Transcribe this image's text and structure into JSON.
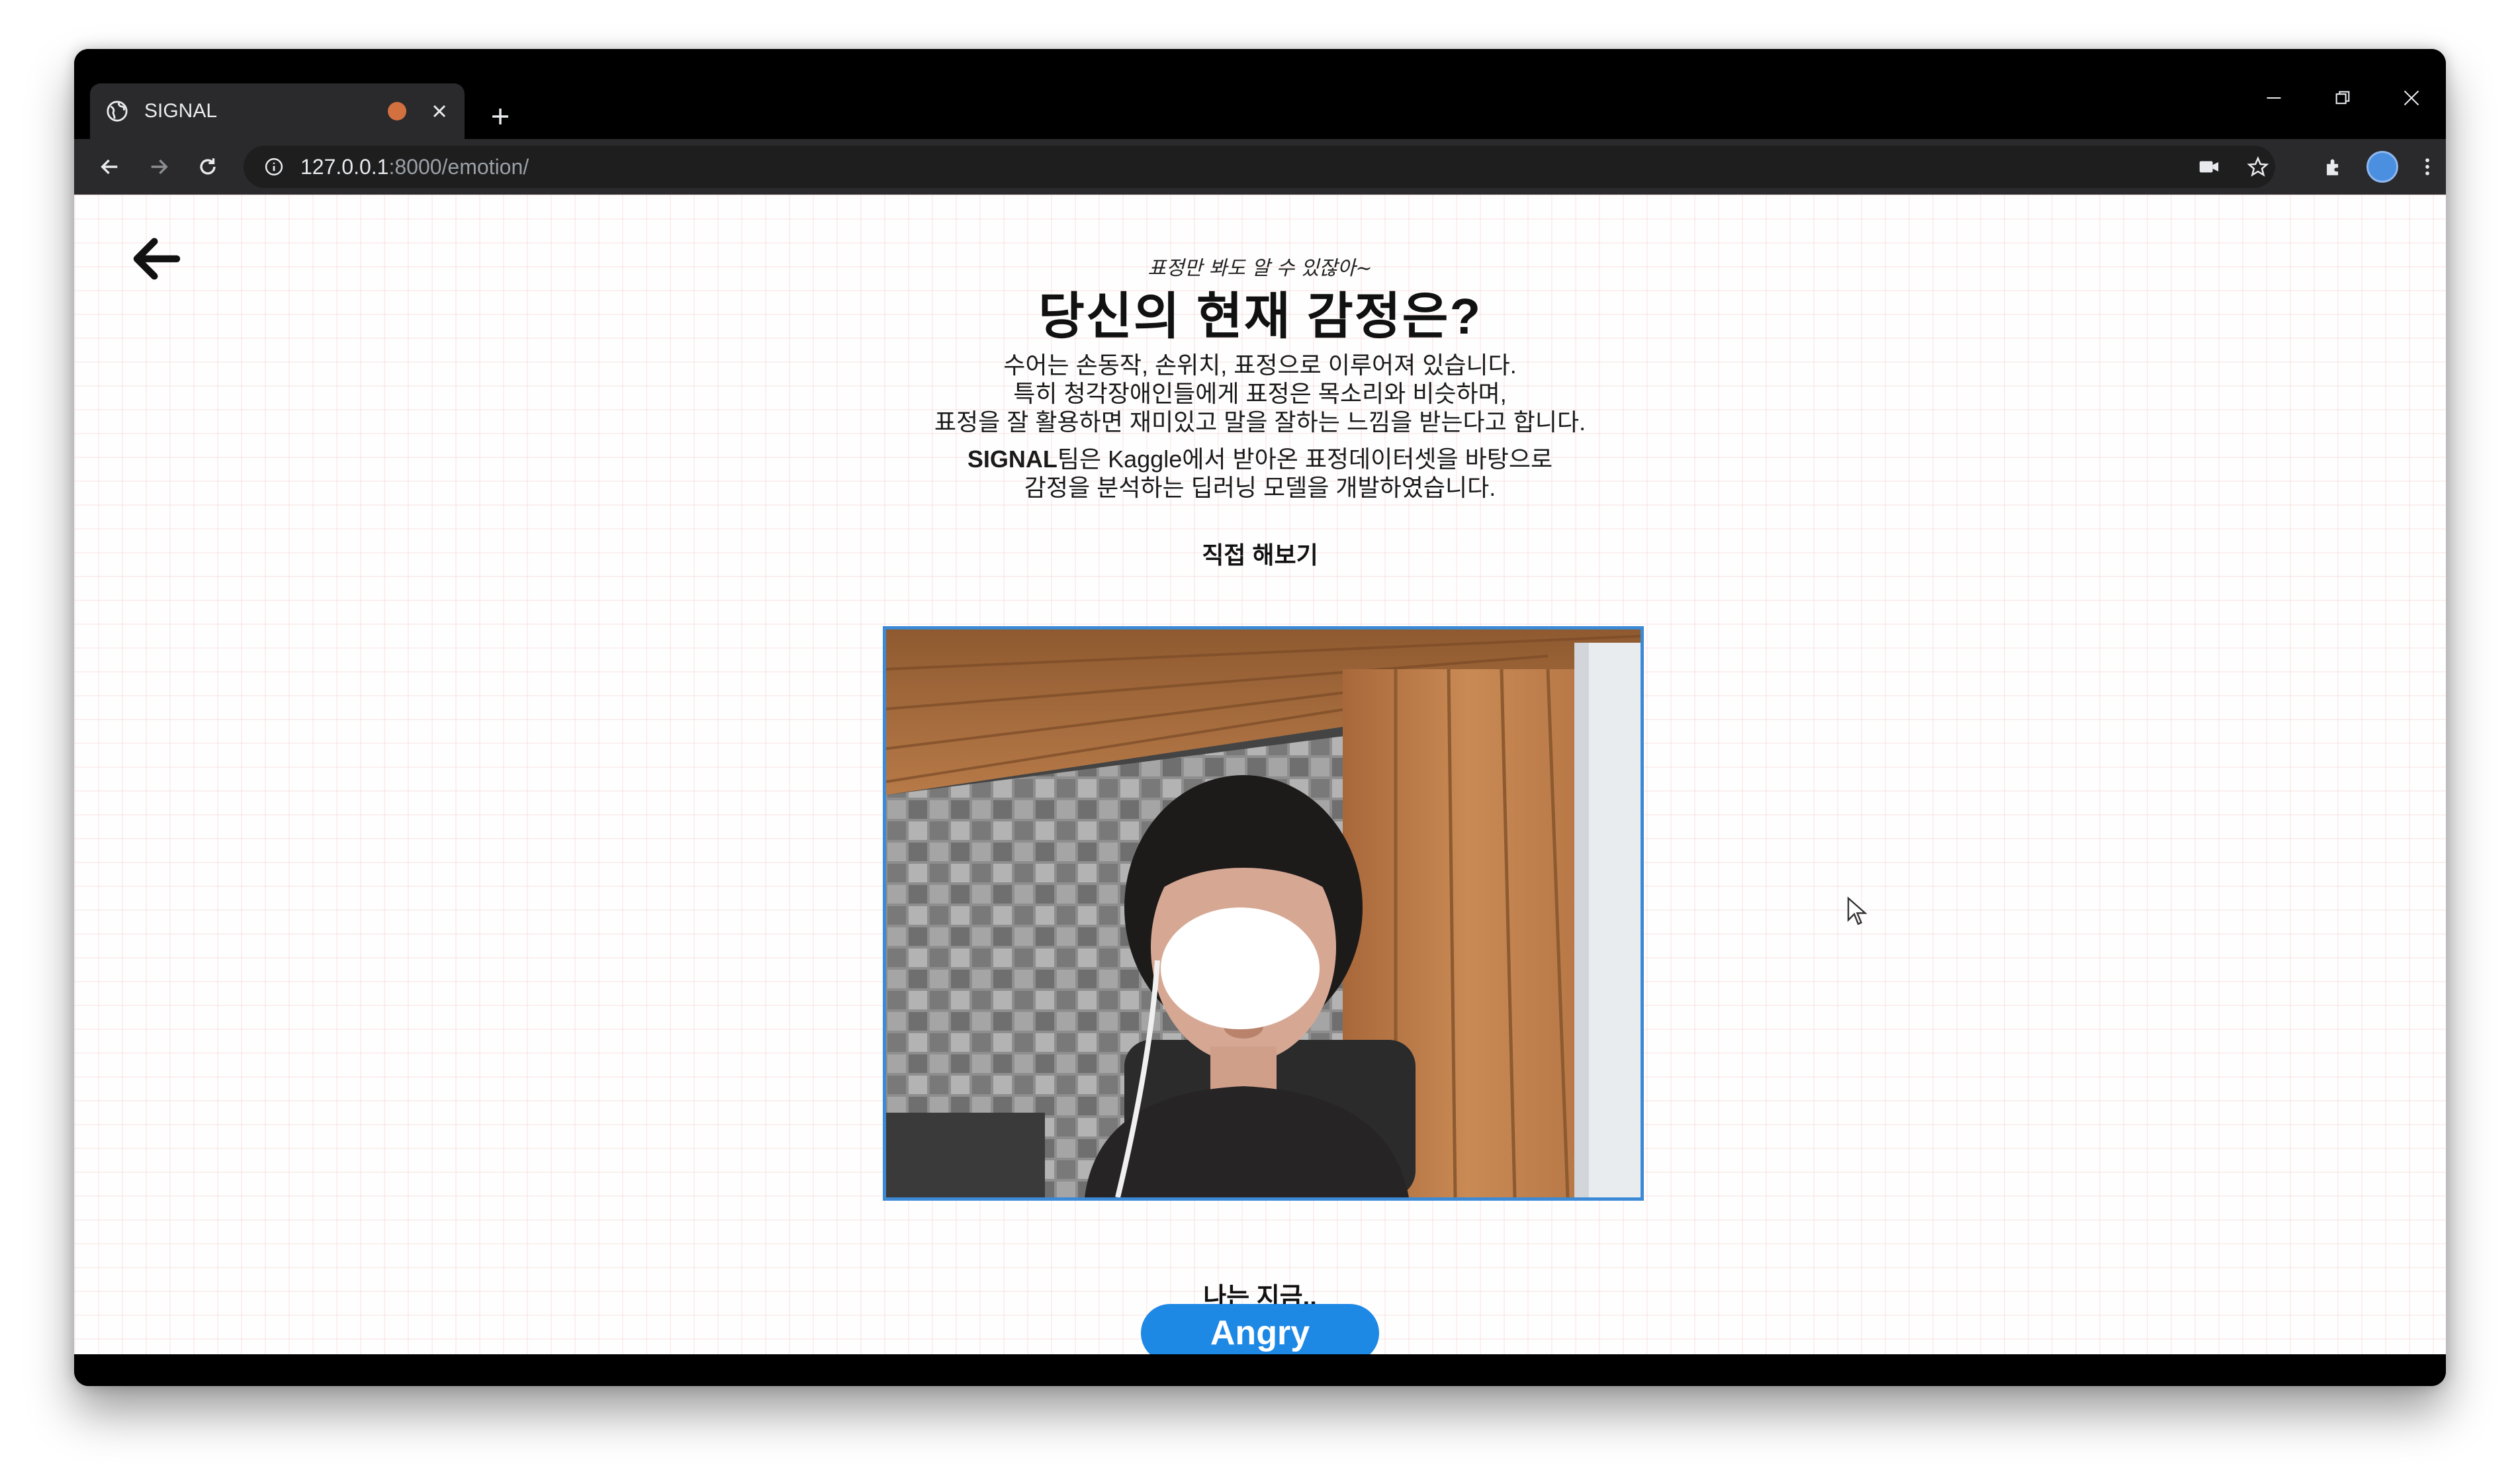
{
  "browser": {
    "tab_title": "SIGNAL",
    "url_host": "127.0.0.1",
    "url_path": ":8000/emotion/"
  },
  "page": {
    "subtitle": "표정만 봐도 알 수 있잖아~",
    "title": "당신의 현재 감정은?",
    "description_lines": [
      "수어는 손동작, 손위치, 표정으로 이루어져 있습니다.",
      "특히 청각장애인들에게 표정은 목소리와 비슷하며,",
      "표정을 잘 활용하면 재미있고 말을 잘하는 느낌을 받는다고 합니다."
    ],
    "team_name": "SIGNAL",
    "team_description_line1": "팀은 Kaggle에서 받아온 표정데이터셋을 바탕으로",
    "team_description_line2": "감정을 분석하는 딥러닝 모델을 개발하였습니다.",
    "try_label": "직접 해보기",
    "result_label": "나는 지금..",
    "emotion_result": "Angry"
  },
  "colors": {
    "accent": "#1e88e5",
    "frame_border": "#3c8ad6",
    "recording_dot": "#d2703f",
    "profile": "#4a8fe0"
  },
  "icons": [
    "globe-icon",
    "close-icon",
    "plus-icon",
    "minimize-icon",
    "restore-icon",
    "back-icon",
    "forward-icon",
    "reload-icon",
    "info-icon",
    "camera-icon",
    "star-icon",
    "extensions-icon",
    "more-icon",
    "back-arrow-icon",
    "cursor-icon"
  ]
}
